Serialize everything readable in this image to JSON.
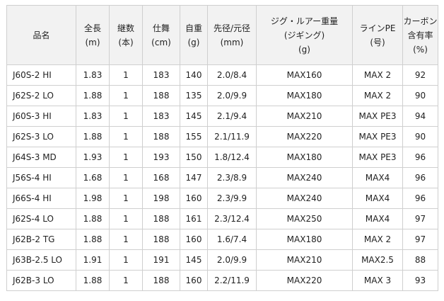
{
  "table": {
    "headers": [
      [
        "品名"
      ],
      [
        "全長",
        "(m)"
      ],
      [
        "継数",
        "(本)"
      ],
      [
        "仕舞",
        "(cm)"
      ],
      [
        "自重",
        "(g)"
      ],
      [
        "先径/元径",
        "(mm)"
      ],
      [
        "ジグ・ルアー重量",
        "(ジギング)",
        "(g)"
      ],
      [
        "ラインPE",
        "(号)"
      ],
      [
        "カーボン",
        "含有率",
        "(%)"
      ]
    ],
    "rows": [
      [
        "J60S-2 HI",
        "1.83",
        "1",
        "183",
        "140",
        "2.0/8.4",
        "MAX160",
        "MAX 2",
        "92"
      ],
      [
        "J62S-2 LO",
        "1.88",
        "1",
        "188",
        "135",
        "2.0/9.9",
        "MAX180",
        "MAX 2",
        "90"
      ],
      [
        "J60S-3 HI",
        "1.83",
        "1",
        "183",
        "145",
        "2.1/9.4",
        "MAX210",
        "MAX PE3",
        "94"
      ],
      [
        "J62S-3 LO",
        "1.88",
        "1",
        "188",
        "155",
        "2.1/11.9",
        "MAX220",
        "MAX PE3",
        "90"
      ],
      [
        "J64S-3 MD",
        "1.93",
        "1",
        "193",
        "150",
        "1.8/12.4",
        "MAX180",
        "MAX PE3",
        "96"
      ],
      [
        "J56S-4 HI",
        "1.68",
        "1",
        "168",
        "147",
        "2.3/8.9",
        "MAX240",
        "MAX4",
        "96"
      ],
      [
        "J66S-4 HI",
        "1.98",
        "1",
        "198",
        "160",
        "2.3/9.9",
        "MAX240",
        "MAX4",
        "96"
      ],
      [
        "J62S-4 LO",
        "1.88",
        "1",
        "188",
        "161",
        "2.3/12.4",
        "MAX250",
        "MAX4",
        "97"
      ],
      [
        "J62B-2 TG",
        "1.88",
        "1",
        "188",
        "160",
        "1.6/7.4",
        "MAX180",
        "MAX 2",
        "97"
      ],
      [
        "J63B-2.5 LO",
        "1.91",
        "1",
        "191",
        "145",
        "2.0/9.9",
        "MAX210",
        "MAX2.5",
        "88"
      ],
      [
        "J62B-3 LO",
        "1.88",
        "1",
        "188",
        "160",
        "2.2/11.9",
        "MAX220",
        "MAX 3",
        "93"
      ]
    ]
  },
  "colors": {
    "header_bg": "#f2f2f2",
    "border": "#cfcfcf",
    "text": "#222222"
  }
}
